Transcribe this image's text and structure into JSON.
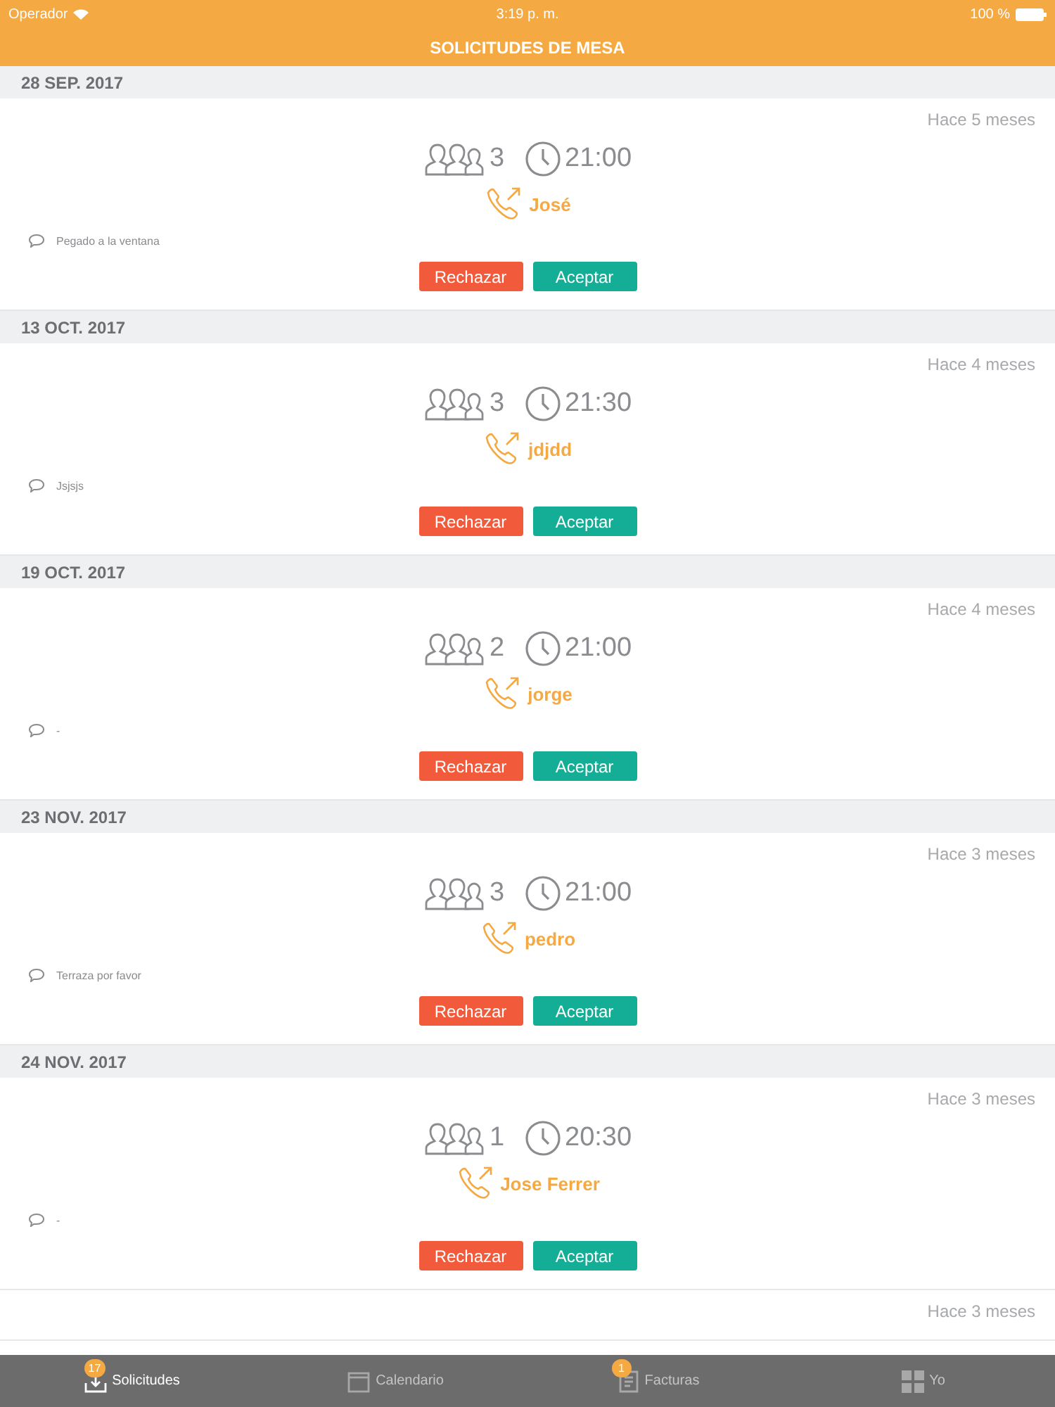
{
  "status_bar": {
    "carrier": "Operador",
    "time": "3:19 p. m.",
    "battery": "100 %"
  },
  "nav": {
    "title": "SOLICITUDES DE MESA"
  },
  "requests": [
    {
      "kind": "full",
      "date": "28 SEP. 2017",
      "time_ago": "Hace 5 meses",
      "guests": "3",
      "time": "21:00",
      "name": "José",
      "comment": "Pegado a la ventana",
      "reject": "Rechazar",
      "accept": "Aceptar"
    },
    {
      "kind": "full",
      "date": "13 OCT. 2017",
      "time_ago": "Hace 4 meses",
      "guests": "3",
      "time": "21:30",
      "name": "jdjdd",
      "comment": "Jsjsjs",
      "reject": "Rechazar",
      "accept": "Aceptar"
    },
    {
      "kind": "full",
      "date": "19 OCT. 2017",
      "time_ago": "Hace 4 meses",
      "guests": "2",
      "time": "21:00",
      "name": "jorge",
      "comment": "-",
      "reject": "Rechazar",
      "accept": "Aceptar"
    },
    {
      "kind": "full",
      "date": "23 NOV. 2017",
      "time_ago": "Hace 3 meses",
      "guests": "3",
      "time": "21:00",
      "name": "pedro",
      "comment": "Terraza por favor",
      "reject": "Rechazar",
      "accept": "Aceptar"
    },
    {
      "kind": "full",
      "date": "24 NOV. 2017",
      "time_ago": "Hace 3 meses",
      "guests": "1",
      "time": "20:30",
      "name": "Jose Ferrer",
      "comment": "-",
      "reject": "Rechazar",
      "accept": "Aceptar"
    },
    {
      "kind": "partial",
      "time_ago": "Hace 3 meses"
    }
  ],
  "tab_bar": [
    {
      "label": "Solicitudes",
      "kind": "inbox",
      "selected": true,
      "badge": "17"
    },
    {
      "label": "Calendario",
      "kind": "calendar",
      "selected": false
    },
    {
      "label": "Facturas",
      "kind": "receipt",
      "selected": false,
      "badge": "1"
    },
    {
      "label": "Yo",
      "kind": "grid",
      "selected": false
    }
  ]
}
